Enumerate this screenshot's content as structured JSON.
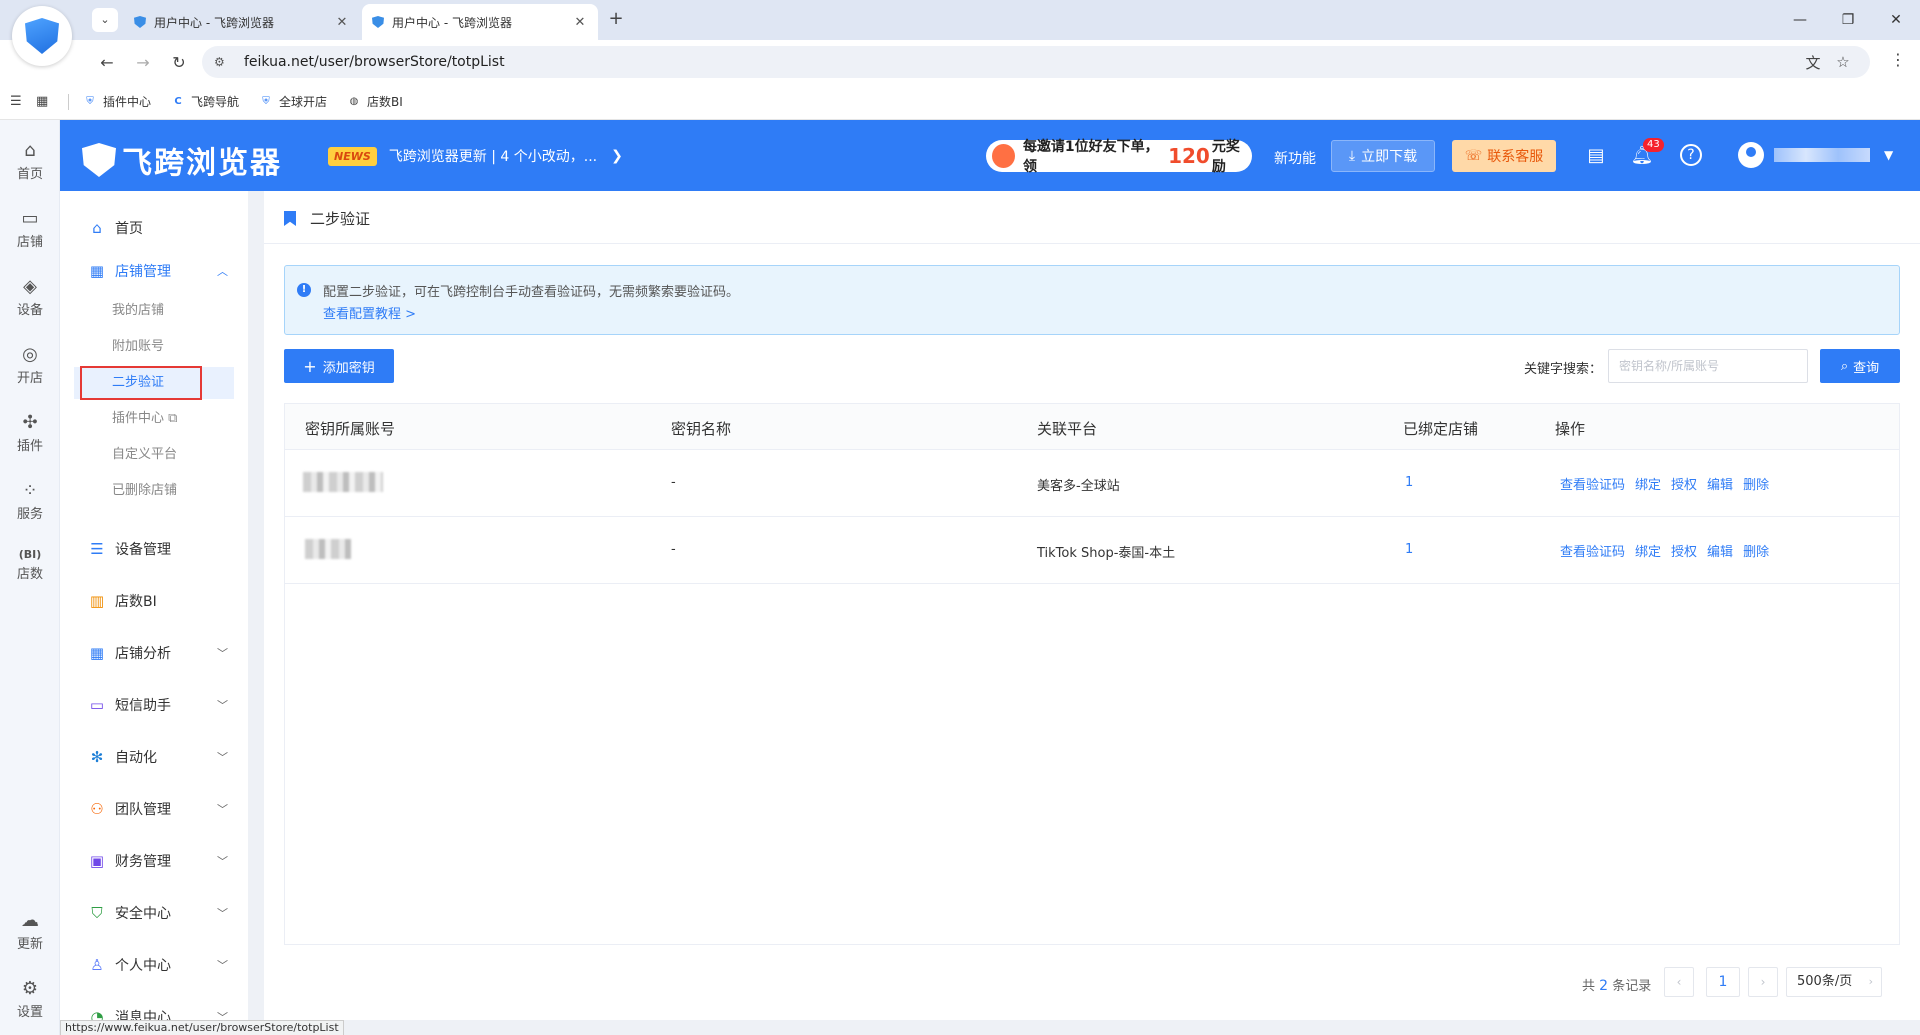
{
  "browser": {
    "tabs": [
      {
        "title": "用户中心 - 飞跨浏览器"
      },
      {
        "title": "用户中心 - 飞跨浏览器"
      }
    ],
    "url": "feikua.net/user/browserStore/totpList",
    "bookmarks": [
      {
        "label": "插件中心",
        "icon": "shield-icon"
      },
      {
        "label": "飞跨导航",
        "icon": "c-logo-icon"
      },
      {
        "label": "全球开店",
        "icon": "shield-icon"
      },
      {
        "label": "店数BI",
        "icon": "globe-icon"
      }
    ],
    "status_url": "https://www.feikua.net/user/browserStore/totpList"
  },
  "header": {
    "brand": "飞跨浏览器",
    "news_badge": "NEWS",
    "news_text": "飞跨浏览器更新 | 4 个小改动，...",
    "invite_prefix": "每邀请1位好友下单，领",
    "invite_amount": "120",
    "invite_suffix": "元奖励",
    "new_feature": "新功能",
    "download": "立即下载",
    "support": "联系客服",
    "notification_count": "43"
  },
  "rail": {
    "items": [
      {
        "label": "首页",
        "icon": "home-icon"
      },
      {
        "label": "店铺",
        "icon": "store-icon"
      },
      {
        "label": "设备",
        "icon": "layers-icon"
      },
      {
        "label": "开店",
        "icon": "planet-icon"
      },
      {
        "label": "插件",
        "icon": "puzzle-icon"
      },
      {
        "label": "服务",
        "icon": "grid-icon"
      },
      {
        "label": "店数",
        "icon": "bi-icon"
      },
      {
        "label": "更新",
        "icon": "cloud-update-icon"
      },
      {
        "label": "设置",
        "icon": "settings-icon"
      }
    ]
  },
  "menu": {
    "home": "首页",
    "store_mgmt": "店铺管理",
    "store_sub": [
      "我的店铺",
      "附加账号",
      "二步验证",
      "插件中心",
      "自定义平台",
      "已删除店铺"
    ],
    "device_mgmt": "设备管理",
    "bi": "店数BI",
    "store_analysis": "店铺分析",
    "sms": "短信助手",
    "automation": "自动化",
    "team": "团队管理",
    "finance": "财务管理",
    "security": "安全中心",
    "personal": "个人中心",
    "messages": "消息中心"
  },
  "page": {
    "title": "二步验证",
    "info": "配置二步验证，可在飞跨控制台手动查看验证码，无需频繁索要验证码。",
    "info_link": "查看配置教程 >",
    "add_button": "添加密钥",
    "keyword_label": "关键字搜索：",
    "keyword_placeholder": "密钥名称/所属账号",
    "search_button": "查询"
  },
  "table": {
    "columns": [
      "密钥所属账号",
      "密钥名称",
      "关联平台",
      "已绑定店铺",
      "操作"
    ],
    "rows": [
      {
        "account": "",
        "name": "-",
        "platform": "美客多-全球站",
        "bound": "1"
      },
      {
        "account": "",
        "name": "-",
        "platform": "TikTok Shop-泰国-本土",
        "bound": "1"
      }
    ],
    "actions": [
      "查看验证码",
      "绑定",
      "授权",
      "编辑",
      "删除"
    ]
  },
  "pager": {
    "total_prefix": "共",
    "total": "2",
    "total_suffix": "条记录",
    "current_page": "1",
    "page_size": "500条/页"
  }
}
